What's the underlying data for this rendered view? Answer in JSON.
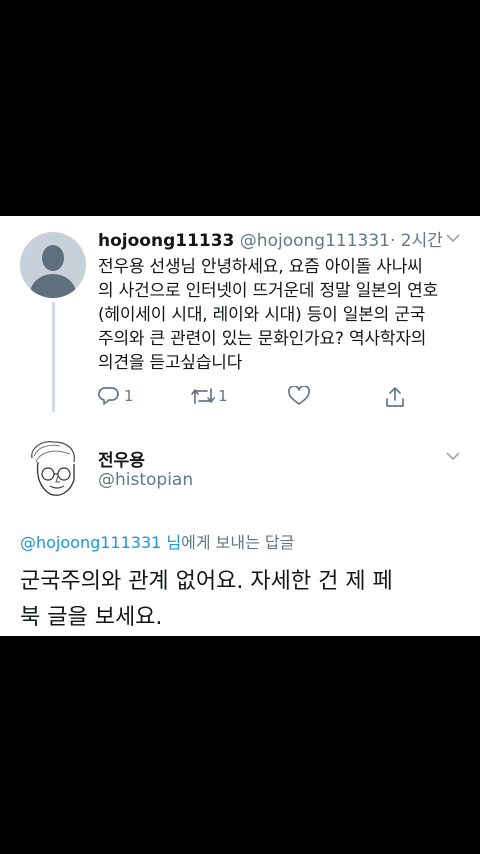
{
  "original_tweet": {
    "display_name": "hojoong11133",
    "handle": "@hojoong111331",
    "time": "· 2시간",
    "lines": [
      "전우용 선생님 안녕하세요, 요즘 아이돌 사나씨",
      "의 사건으로 인터넷이 뜨거운데 정말 일본의 연호",
      "(헤이세이 시대, 레이와 시대) 등이 일본의 군국",
      "주의와 큰 관련이 있는 문화인가요? 역사학자의",
      "의견을 듣고싶습니다"
    ],
    "reply_count": "1",
    "retweet_count": "1"
  },
  "reply_tweet": {
    "display_name": "전우용",
    "handle": "@histopian",
    "replying_to_mention": "@hojoong111331 님",
    "replying_to_suffix": "에게 보내는 답글",
    "lines": [
      "군국주의와 관계 없어요. 자세한 건 제 페",
      "북 글을 보세요."
    ]
  },
  "colors": {
    "accent": "#1b95e0",
    "secondary_text": "#657786",
    "primary_text": "#14171a"
  },
  "icons": [
    "reply-icon",
    "retweet-icon",
    "like-icon",
    "share-icon",
    "chevron-down-icon"
  ]
}
